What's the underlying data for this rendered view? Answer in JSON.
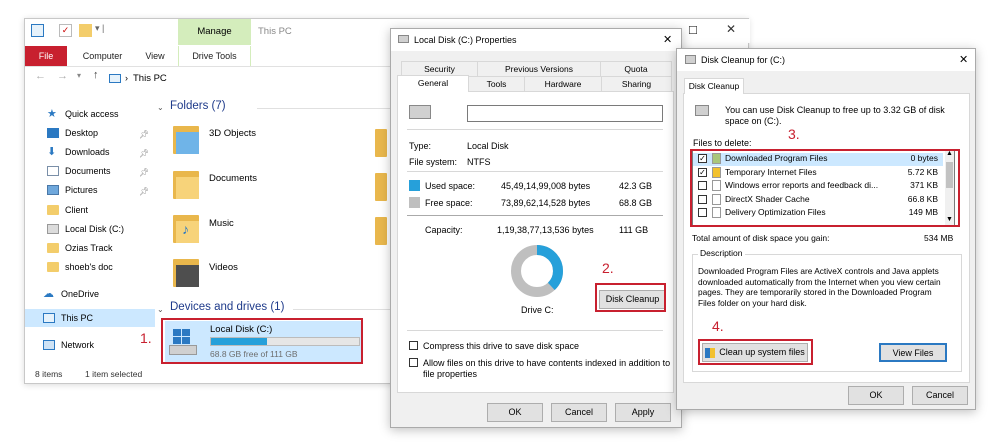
{
  "explorer": {
    "manage_tab": "Manage",
    "title": "This PC",
    "tabs": [
      "File",
      "Computer",
      "View",
      "Drive Tools"
    ],
    "address": "This PC",
    "sidebar": [
      {
        "label": "Quick access",
        "pinned": false
      },
      {
        "label": "Desktop",
        "pinned": true
      },
      {
        "label": "Downloads",
        "pinned": true
      },
      {
        "label": "Documents",
        "pinned": true
      },
      {
        "label": "Pictures",
        "pinned": true
      },
      {
        "label": "Client",
        "pinned": false
      },
      {
        "label": "Local Disk (C:)",
        "pinned": false
      },
      {
        "label": "Ozias Track",
        "pinned": false
      },
      {
        "label": "shoeb's doc",
        "pinned": false
      },
      {
        "label": "OneDrive",
        "pinned": false
      },
      {
        "label": "This PC",
        "pinned": false
      },
      {
        "label": "Network",
        "pinned": false
      }
    ],
    "folders_header": "Folders (7)",
    "folders": [
      "3D Objects",
      "Documents",
      "Music",
      "Videos"
    ],
    "devices_header": "Devices and drives (1)",
    "drive": {
      "name": "Local Disk (C:)",
      "free_text": "68.8 GB free of 111 GB",
      "used_fraction": 0.38
    },
    "status_items": "8 items",
    "status_selected": "1 item selected"
  },
  "props": {
    "title": "Local Disk (C:) Properties",
    "tabs_row1": [
      "Security",
      "Previous Versions",
      "Quota"
    ],
    "tabs_row2": [
      "General",
      "Tools",
      "Hardware",
      "Sharing"
    ],
    "type_label": "Type:",
    "type_value": "Local Disk",
    "fs_label": "File system:",
    "fs_value": "NTFS",
    "used_label": "Used space:",
    "used_bytes": "45,49,14,99,008 bytes",
    "used_gb": "42.3 GB",
    "free_label": "Free space:",
    "free_bytes": "73,89,62,14,528 bytes",
    "free_gb": "68.8 GB",
    "cap_label": "Capacity:",
    "cap_bytes": "1,19,38,77,13,536 bytes",
    "cap_gb": "111 GB",
    "drive_label": "Drive C:",
    "cleanup_button": "Disk Cleanup",
    "compress_label": "Compress this drive to save disk space",
    "index_label_1": "Allow files on this drive to have contents indexed in addition to",
    "index_label_2": "file properties",
    "ok": "OK",
    "cancel": "Cancel",
    "apply": "Apply",
    "used_color": "#26a0da",
    "free_color": "#bfbfbf"
  },
  "cleanup": {
    "title": "Disk Cleanup for  (C:)",
    "tab": "Disk Cleanup",
    "intro_1": "You can use Disk Cleanup to free up to 3.32 GB of disk",
    "intro_2": "space on  (C:).",
    "files_label": "Files to delete:",
    "files": [
      {
        "name": "Downloaded Program Files",
        "size": "0 bytes",
        "checked": true
      },
      {
        "name": "Temporary Internet Files",
        "size": "5.72 KB",
        "checked": true
      },
      {
        "name": "Windows error reports and feedback di...",
        "size": "371 KB",
        "checked": false
      },
      {
        "name": "DirectX Shader Cache",
        "size": "66.8 KB",
        "checked": false
      },
      {
        "name": "Delivery Optimization Files",
        "size": "149 MB",
        "checked": false
      }
    ],
    "total_label": "Total amount of disk space you gain:",
    "total_value": "534 MB",
    "desc_label": "Description",
    "desc_1": "Downloaded Program Files are ActiveX controls and Java applets",
    "desc_2": "downloaded automatically from the Internet when you view certain",
    "desc_3": "pages. They are temporarily stored in the Downloaded Program",
    "desc_4": "Files folder on your hard disk.",
    "cleanup_system_button": "Clean up system files",
    "view_files_button": "View Files",
    "ok": "OK",
    "cancel": "Cancel"
  },
  "steps": [
    "1.",
    "2.",
    "3.",
    "4."
  ],
  "accent_red": "#c8202f",
  "manage_color": "#d4edbc"
}
